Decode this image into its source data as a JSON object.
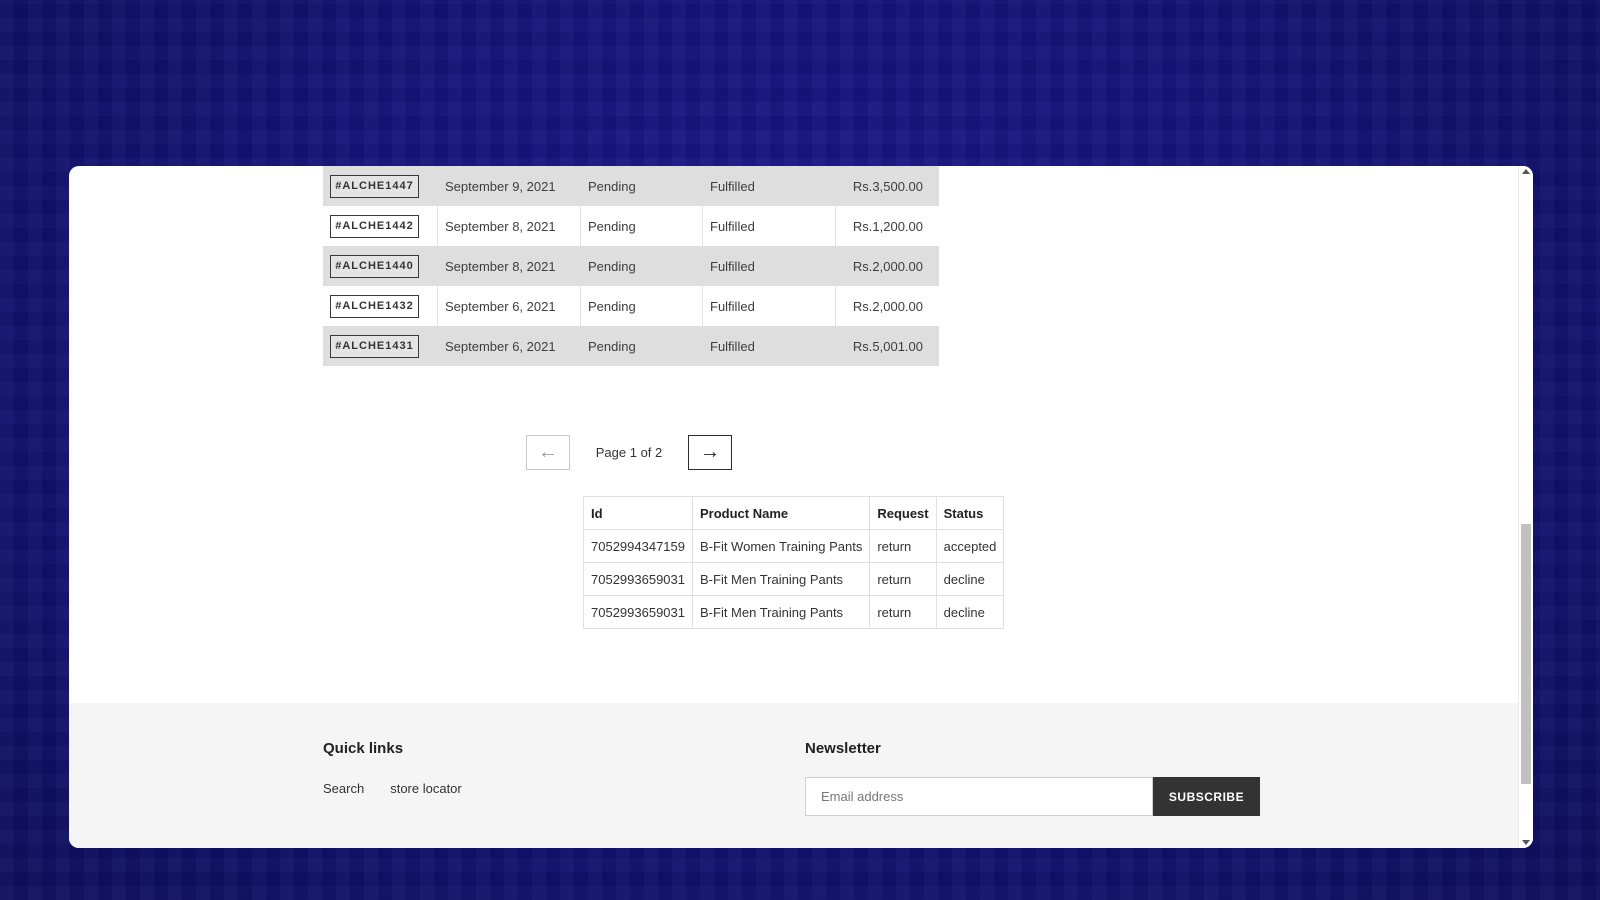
{
  "orders": [
    {
      "id": "#ALCHE1447",
      "date": "September 9, 2021",
      "payment": "Pending",
      "fulfillment": "Fulfilled",
      "total": "Rs.3,500.00"
    },
    {
      "id": "#ALCHE1442",
      "date": "September 8, 2021",
      "payment": "Pending",
      "fulfillment": "Fulfilled",
      "total": "Rs.1,200.00"
    },
    {
      "id": "#ALCHE1440",
      "date": "September 8, 2021",
      "payment": "Pending",
      "fulfillment": "Fulfilled",
      "total": "Rs.2,000.00"
    },
    {
      "id": "#ALCHE1432",
      "date": "September 6, 2021",
      "payment": "Pending",
      "fulfillment": "Fulfilled",
      "total": "Rs.2,000.00"
    },
    {
      "id": "#ALCHE1431",
      "date": "September 6, 2021",
      "payment": "Pending",
      "fulfillment": "Fulfilled",
      "total": "Rs.5,001.00"
    }
  ],
  "pagination": {
    "prev_icon": "arrow-left-icon",
    "prev_glyph": "←",
    "label": "Page 1 of 2",
    "next_icon": "arrow-right-icon",
    "next_glyph": "→"
  },
  "returns": {
    "headers": [
      "Id",
      "Product Name",
      "Request",
      "Status"
    ],
    "rows": [
      [
        "7052994347159",
        "B-Fit Women Training Pants",
        "return",
        "accepted"
      ],
      [
        "7052993659031",
        "B-Fit Men Training Pants",
        "return",
        "decline"
      ],
      [
        "7052993659031",
        "B-Fit Men Training Pants",
        "return",
        "decline"
      ]
    ]
  },
  "footer": {
    "quick_links_title": "Quick links",
    "quick_links": [
      "Search",
      "store locator"
    ],
    "newsletter_title": "Newsletter",
    "email_placeholder": "Email address",
    "subscribe_label": "SUBSCRIBE"
  },
  "colors": {
    "background": "#14147a",
    "row_shade": "#dedede",
    "footer_bg": "#f5f5f5",
    "button_dark": "#333333"
  }
}
